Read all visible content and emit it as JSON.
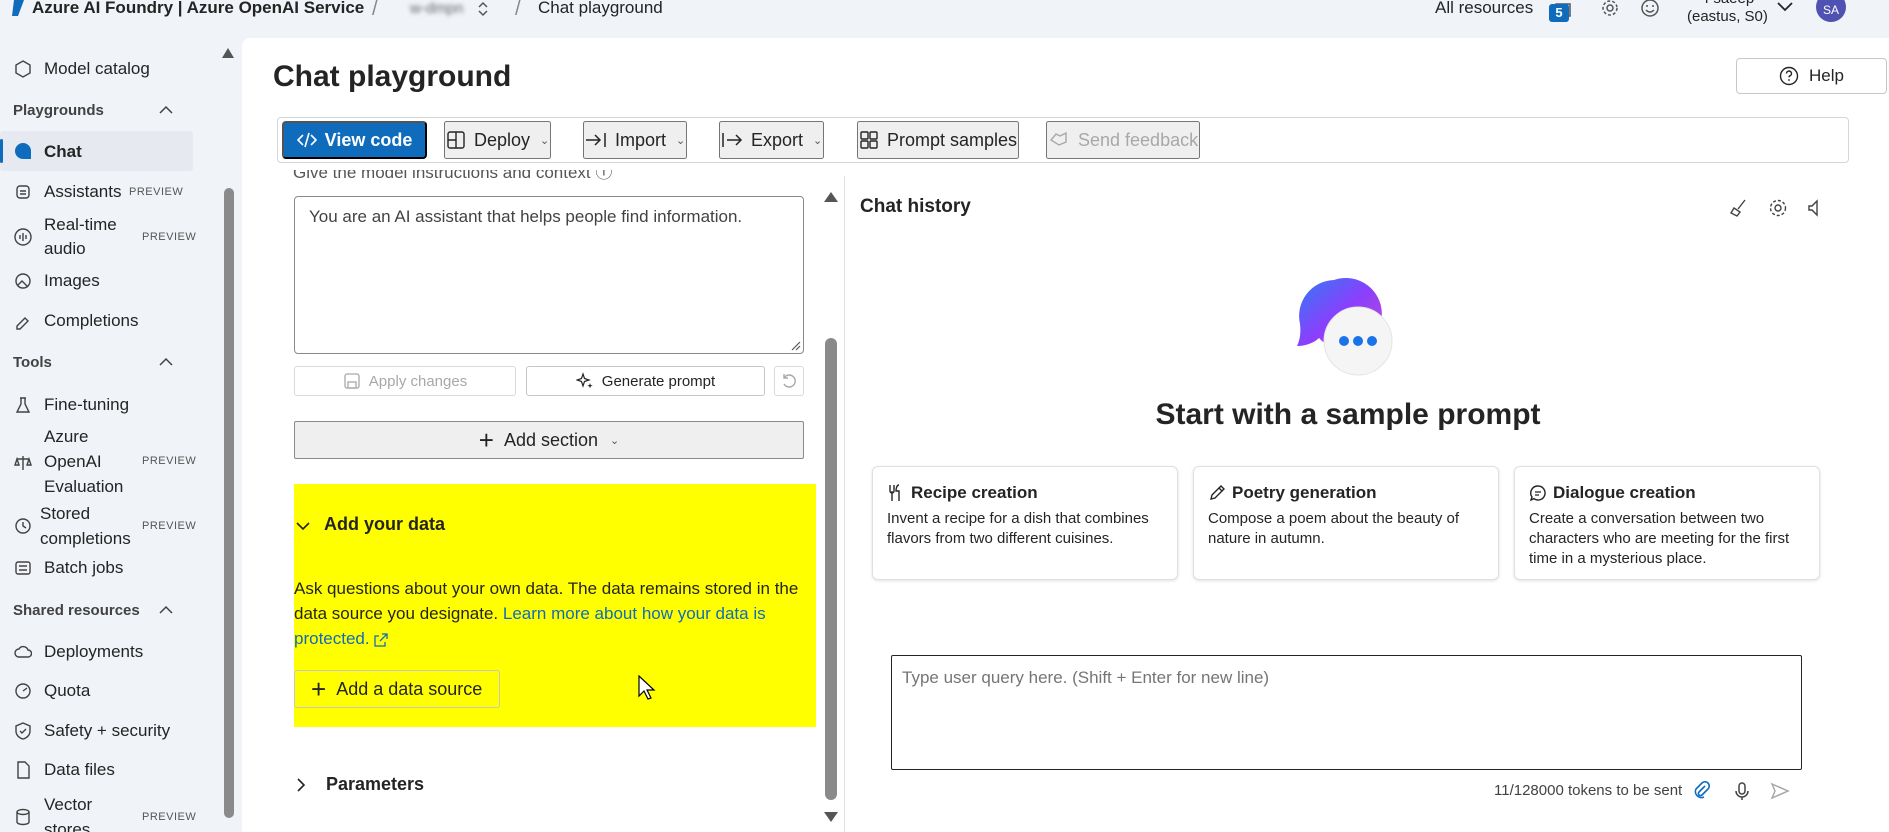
{
  "topbar": {
    "app_title": "Azure AI Foundry | Azure OpenAI Service",
    "project": "w-dmpn",
    "page": "Chat playground",
    "all_resources": "All resources",
    "notification_count": "5",
    "user_name": "i-saeep",
    "user_region": "(eastus, S0)",
    "avatar_initials": "SA"
  },
  "sidebar": {
    "model_catalog": "Model catalog",
    "playgrounds_head": "Playgrounds",
    "chat": "Chat",
    "assistants": "Assistants",
    "realtime_audio_1": "Real-time",
    "realtime_audio_2": "audio",
    "images": "Images",
    "completions": "Completions",
    "tools_head": "Tools",
    "fine_tuning": "Fine-tuning",
    "eval_1": "Azure",
    "eval_2": "OpenAI",
    "eval_3": "Evaluation",
    "stored_1": "Stored",
    "stored_2": "completions",
    "batch_jobs": "Batch jobs",
    "shared_head": "Shared resources",
    "deployments": "Deployments",
    "quota": "Quota",
    "safety": "Safety + security",
    "data_files": "Data files",
    "vector_1": "Vector",
    "vector_2": "stores",
    "preview": "PREVIEW"
  },
  "main": {
    "title": "Chat playground",
    "help": "Help"
  },
  "toolbar": {
    "view_code": "View code",
    "deploy": "Deploy",
    "import": "Import",
    "export": "Export",
    "prompt_samples": "Prompt samples",
    "send_feedback": "Send feedback"
  },
  "setup": {
    "instructions_label": "Give the model instructions and context",
    "system_message": "You are an AI assistant that helps people find information.",
    "apply_changes": "Apply changes",
    "generate_prompt": "Generate prompt",
    "add_section": "Add section",
    "add_your_data": "Add your data",
    "data_desc": "Ask questions about your own data. The data remains stored in the data source you designate.",
    "data_link": "Learn more about how your data is protected.",
    "add_data_source": "Add a data source",
    "parameters": "Parameters"
  },
  "chat": {
    "history_title": "Chat history",
    "start_title": "Start with a sample prompt",
    "cards": [
      {
        "title": "Recipe creation",
        "desc": "Invent a recipe for a dish that combines flavors from two different cuisines."
      },
      {
        "title": "Poetry generation",
        "desc": "Compose a poem about the beauty of nature in autumn."
      },
      {
        "title": "Dialogue creation",
        "desc": "Create a conversation between two characters who are meeting for the first time in a mysterious place."
      }
    ],
    "query_placeholder": "Type user query here. (Shift + Enter for new line)",
    "token_info": "11/128000 tokens to be sent"
  },
  "colors": {
    "accent": "#0f6cbd",
    "highlight": "#ffff00"
  }
}
